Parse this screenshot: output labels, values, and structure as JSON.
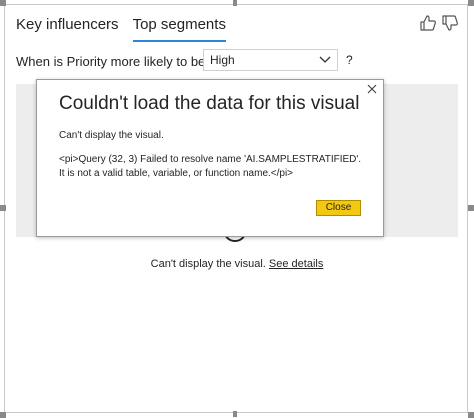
{
  "tabs": [
    {
      "label": "Key influencers",
      "active": false
    },
    {
      "label": "Top segments",
      "active": true
    }
  ],
  "feedback": {
    "thumbs_up_icon": "thumbs-up-icon",
    "thumbs_down_icon": "thumbs-down-icon"
  },
  "question": {
    "label": "When is Priority more likely to be",
    "selected_value": "High",
    "help": "?"
  },
  "status": {
    "message": "Can't display the visual.",
    "link": "See details"
  },
  "dialog": {
    "title": "Couldn't load the data for this visual",
    "subtitle": "Can't display the visual.",
    "message": "<pi>Query (32, 3) Failed to resolve name 'AI.SAMPLESTRATIFIED'. It is not a valid table, variable, or function name.</pi>",
    "close_label": "Close",
    "close_icon": "close-icon"
  },
  "colors": {
    "accent": "#2b88d8",
    "button": "#f2c811",
    "overlay": "#ededed"
  }
}
